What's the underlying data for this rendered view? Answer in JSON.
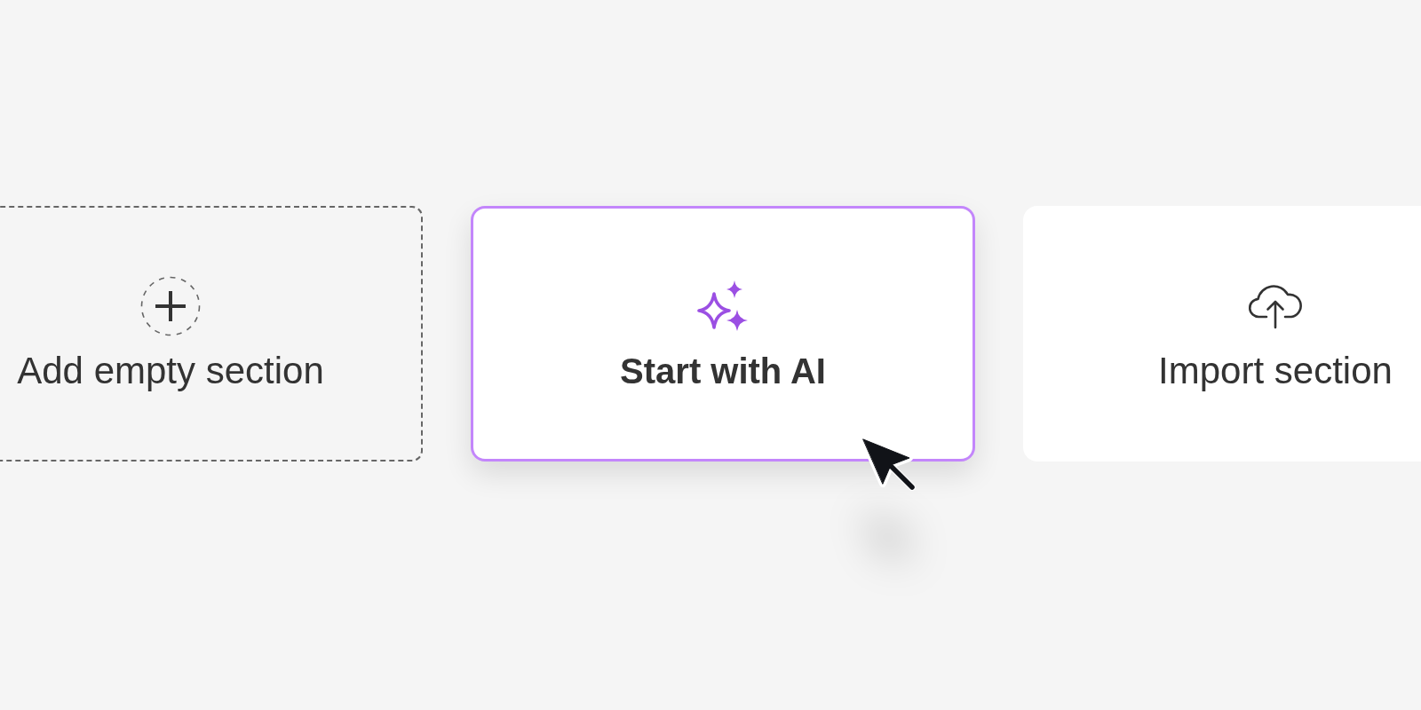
{
  "cards": [
    {
      "kind": "add",
      "label": "Add empty section",
      "selected": false
    },
    {
      "kind": "ai",
      "label": "Start with AI",
      "selected": true
    },
    {
      "kind": "import",
      "label": "Import section",
      "selected": false
    }
  ]
}
